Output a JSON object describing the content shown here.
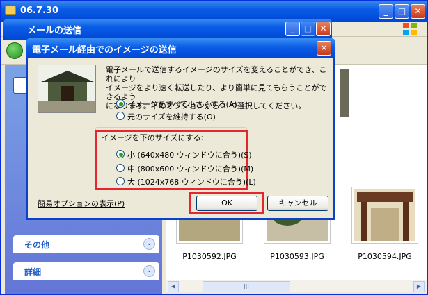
{
  "back_window": {
    "title": "06.7.30",
    "sidebar_panels": [
      {
        "label": "その他"
      },
      {
        "label": "詳細"
      }
    ],
    "thumbnails": [
      {
        "name": "P1030592.JPG"
      },
      {
        "name": "P1030593.JPG"
      },
      {
        "name": "P1030594.JPG"
      }
    ]
  },
  "mid_window": {
    "title": "メールの送信"
  },
  "dialog": {
    "title": "電子メール経由でのイメージの送信",
    "message": "電子メールで送信するイメージのサイズを変えることができ、これにより\nイメージをより速く転送したり、より簡単に見てもらうことができるよう\nになります。下のオプションから 1 つ選択してください。",
    "options": [
      {
        "label": "イメージをすべて小さくする(A)",
        "checked": true
      },
      {
        "label": "元のサイズを維持する(O)",
        "checked": false
      }
    ],
    "group_label": "イメージを下のサイズにする:",
    "sizes": [
      {
        "label": "小 (640x480 ウィンドウに合う)(S)",
        "checked": true
      },
      {
        "label": "中 (800x600 ウィンドウに合う)(M)",
        "checked": false
      },
      {
        "label": "大 (1024x768 ウィンドウに合う)(L)",
        "checked": false
      }
    ],
    "options_link": "簡易オプションの表示(P)",
    "ok_label": "OK",
    "cancel_label": "キャンセル"
  },
  "colors": {
    "titlebar": "#0a5ce6",
    "highlight": "#e4262e",
    "radio_dot": "#21a121"
  }
}
